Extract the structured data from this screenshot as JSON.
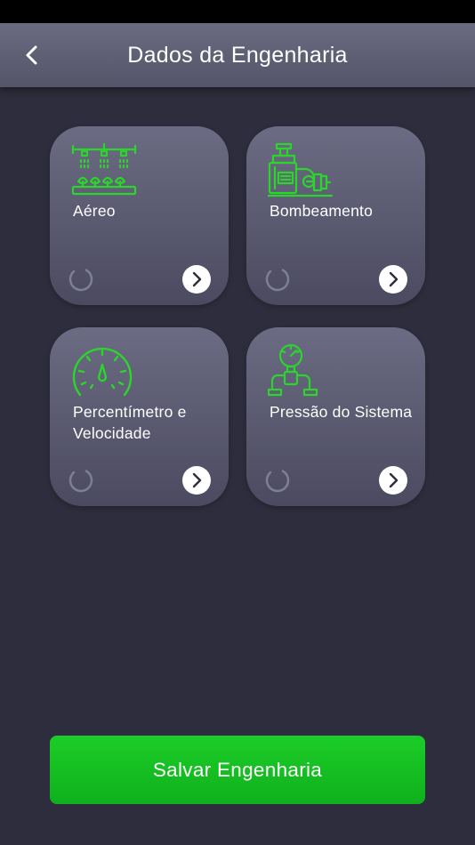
{
  "header": {
    "title": "Dados da Engenharia",
    "back_icon": "chevron-left-icon"
  },
  "cards": [
    {
      "label": "Aéreo",
      "icon": "sprinkler-icon"
    },
    {
      "label": "Bombeamento",
      "icon": "pump-icon"
    },
    {
      "label": "Percentímetro e Velocidade",
      "icon": "speedometer-icon"
    },
    {
      "label": "Pressão do Sistema",
      "icon": "pressure-gauge-icon"
    }
  ],
  "save_button": {
    "label": "Salvar Engenharia"
  },
  "colors": {
    "background": "#2e2d3d",
    "accent_green": "#18c524",
    "icon_green": "#2bd52b",
    "card_top": "#6b6b83",
    "card_bottom": "#4b4a60"
  }
}
